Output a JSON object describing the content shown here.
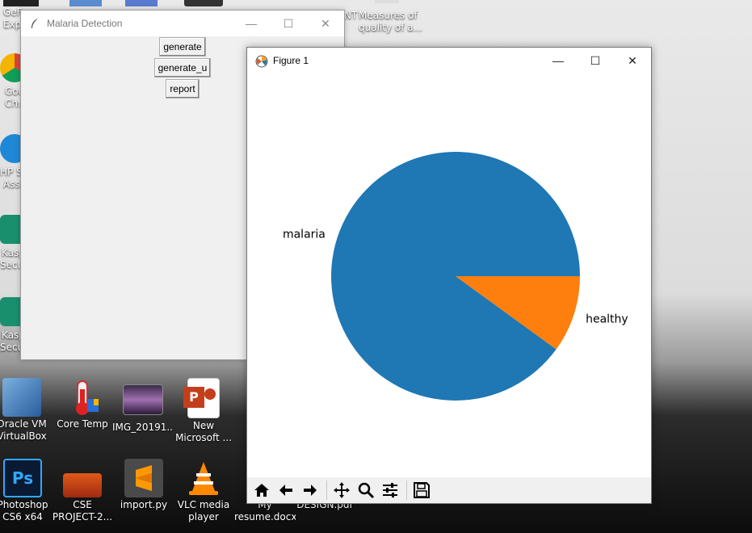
{
  "desktop": {
    "top_icons": [
      {
        "label": "GeF",
        "label2": "Expe"
      },
      {
        "label": "NT",
        "label2": ""
      },
      {
        "label": "Measures of",
        "label2": "quality of a..."
      }
    ],
    "left_icons": [
      {
        "label": "Goo",
        "label2": "Chr"
      },
      {
        "label": "HP Su",
        "label2": "Assi"
      },
      {
        "label": "Kasp",
        "label2": "Secur"
      },
      {
        "label": "Kasp",
        "label2": "Secu"
      }
    ],
    "icons": [
      {
        "label": "Oracle VM",
        "label2": "VirtualBox"
      },
      {
        "label": "Core Temp",
        "label2": ""
      },
      {
        "label": "IMG_20191...",
        "label2": ""
      },
      {
        "label": "New",
        "label2": "Microsoft ..."
      },
      {
        "label": "Photoshop",
        "label2": "CS6 x64"
      },
      {
        "label": "CSE",
        "label2": "PROJECT-2..."
      },
      {
        "label": "import.py",
        "label2": ""
      },
      {
        "label": "VLC media",
        "label2": "player"
      },
      {
        "label": "My",
        "label2": "resume.docx"
      },
      {
        "label": "",
        "label2": "DESIGN.pdf"
      }
    ]
  },
  "tk_window": {
    "title": "Malaria Detection",
    "buttons": {
      "generate": "generate",
      "generate_u": "generate_u",
      "report": "report"
    }
  },
  "figure_window": {
    "title": "Figure 1"
  },
  "chart_data": {
    "type": "pie",
    "labels": [
      "malaria",
      "healthy"
    ],
    "values": [
      90,
      10
    ],
    "colors": [
      "#1f77b4",
      "#ff7f0e"
    ],
    "title": ""
  },
  "toolbar": {
    "tools": [
      "home-icon",
      "back-icon",
      "forward-icon",
      "pan-icon",
      "zoom-icon",
      "configure-subplots-icon",
      "save-icon"
    ]
  }
}
